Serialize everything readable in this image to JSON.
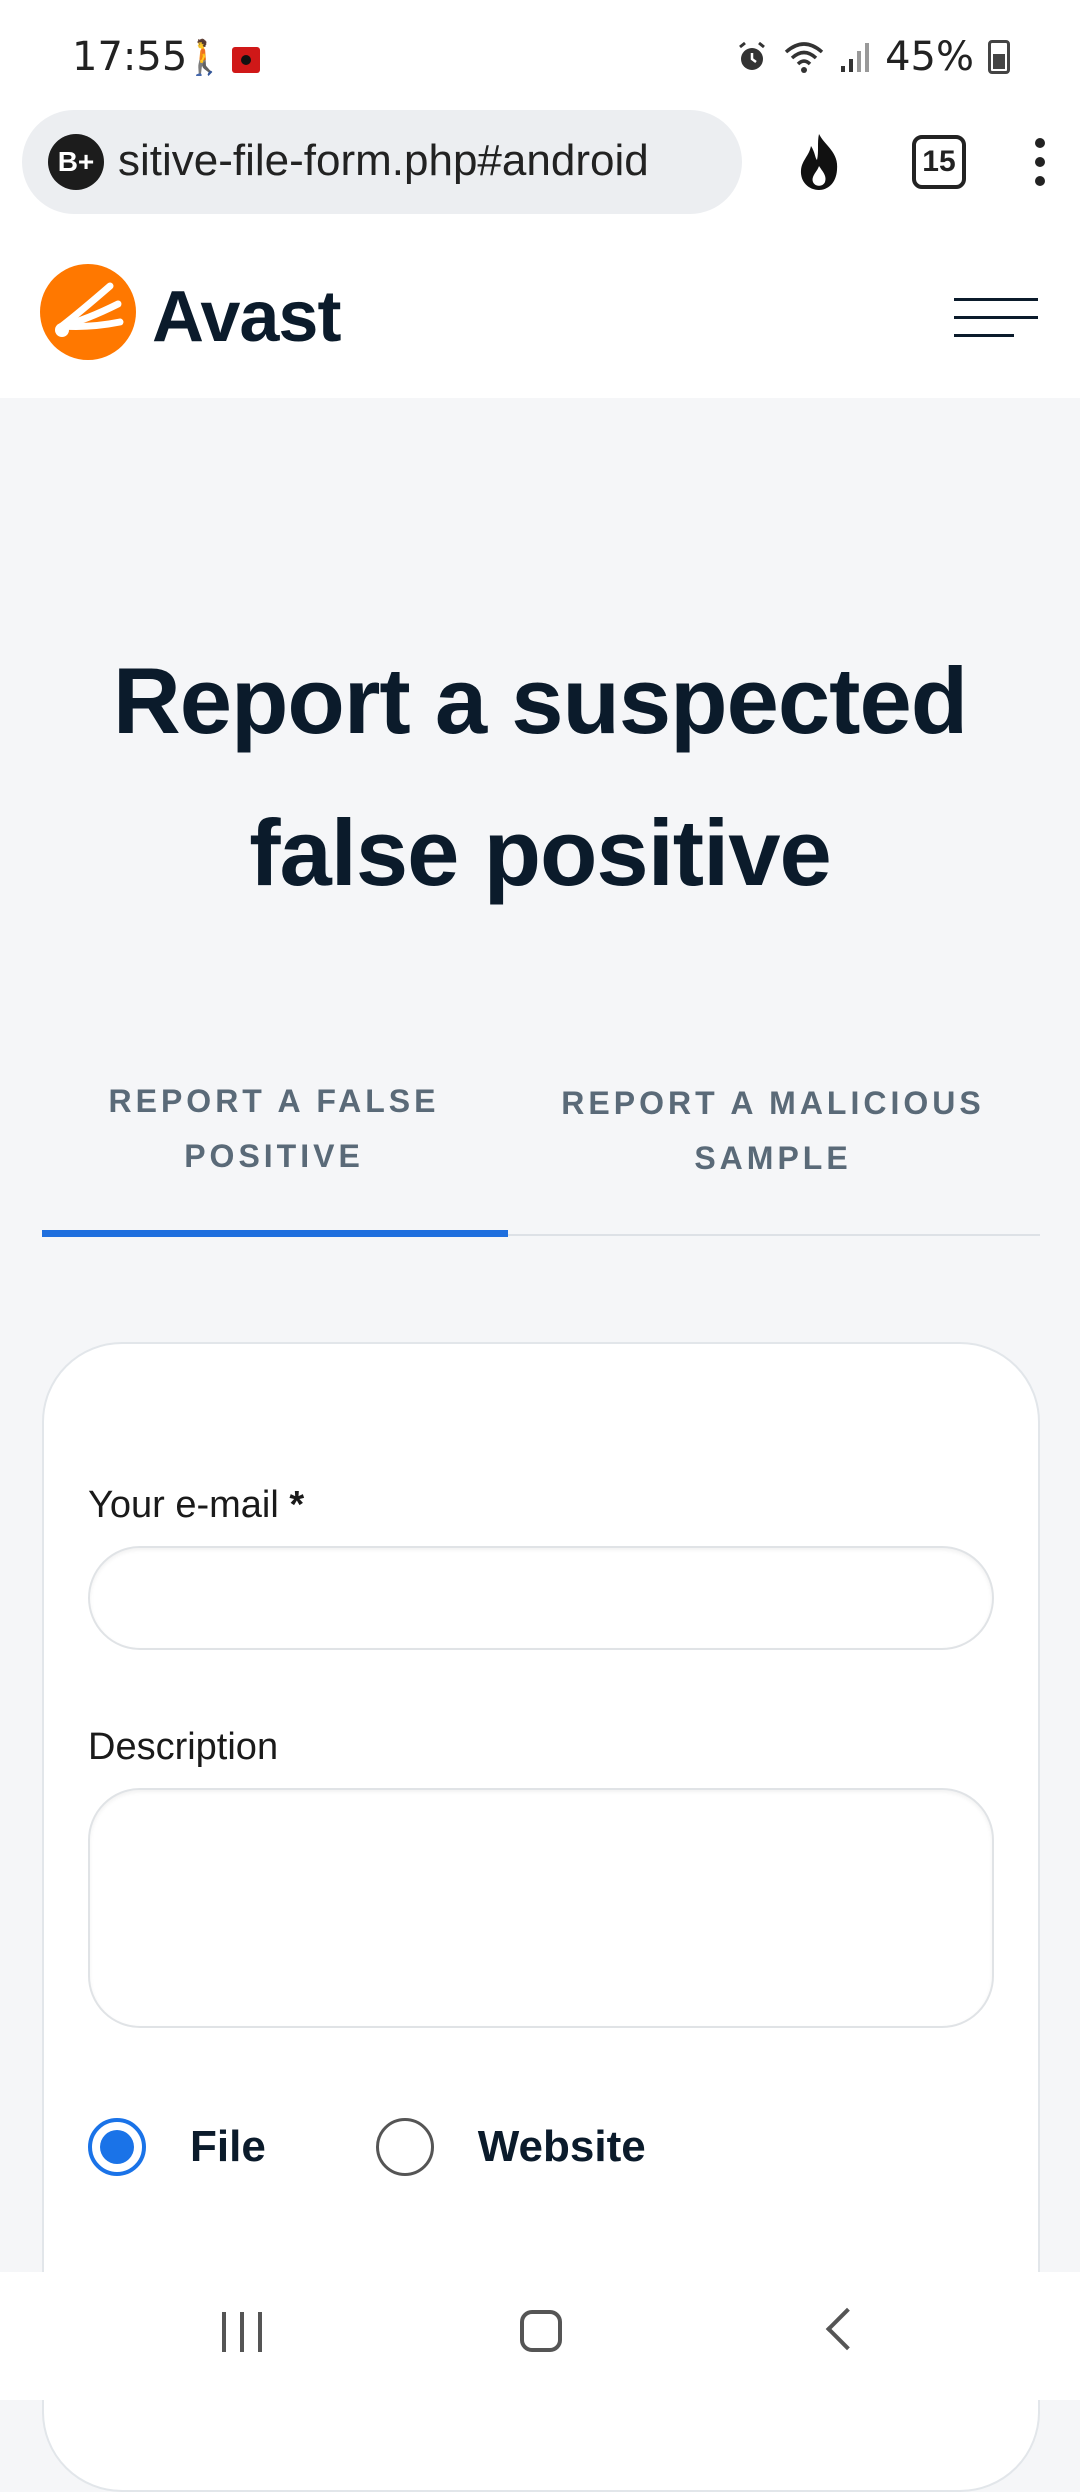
{
  "status_bar": {
    "time": "17:55",
    "battery_percent": "45%",
    "battery_level": 0.45,
    "icons": [
      "walking-person-icon",
      "screen-record-icon",
      "alarm-icon",
      "wifi-icon",
      "signal-icon",
      "battery-icon"
    ]
  },
  "browser": {
    "badge": "B+",
    "url_text": "sitive-file-form.php#android",
    "tab_count": "15",
    "icons": [
      "flame-icon",
      "tabs-icon",
      "more-icon"
    ]
  },
  "site": {
    "brand": "Avast",
    "accent_color": "#ff7800"
  },
  "page": {
    "title": "Report a suspected false positive"
  },
  "tabs": [
    {
      "label": "REPORT A FALSE POSITIVE",
      "active": true
    },
    {
      "label": "REPORT A MALICIOUS SAMPLE",
      "active": false
    }
  ],
  "form": {
    "email_label": "Your e-mail",
    "required_marker": "*",
    "email_value": "",
    "description_label": "Description",
    "description_value": "",
    "radio_options": [
      {
        "label": "File",
        "checked": true
      },
      {
        "label": "Website",
        "checked": false
      }
    ]
  },
  "colors": {
    "primary_blue": "#1a73e8",
    "title_navy": "#0b1b2b",
    "page_bg": "#f5f6f8"
  }
}
